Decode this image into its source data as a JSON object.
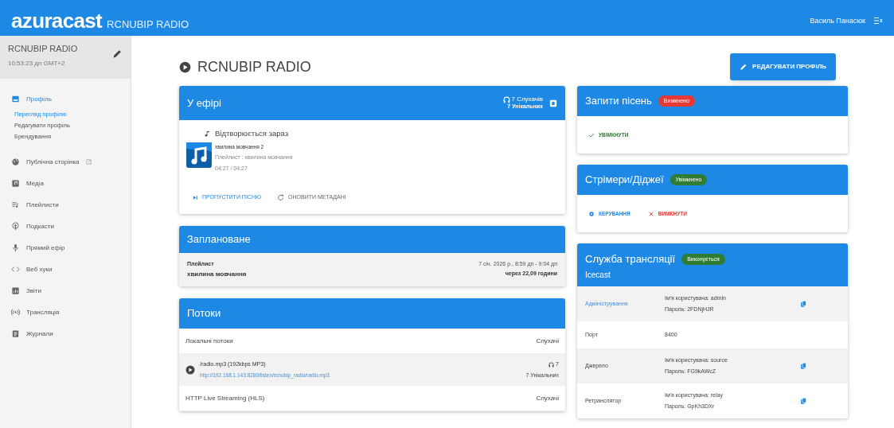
{
  "header": {
    "logo": "azuracast",
    "station": "RCNUBIP RADIO",
    "user": "Василь Панасюк"
  },
  "sidebar": {
    "station": "RCNUBIP RADIO",
    "time": "10:53:23 дп GMT+2",
    "items": [
      {
        "label": "Профіль",
        "selected": true,
        "external": false,
        "children": [
          {
            "label": "Перегляд профілю",
            "selected": true
          },
          {
            "label": "Редагувати профіль",
            "selected": false
          },
          {
            "label": "Брендування",
            "selected": false
          }
        ]
      },
      {
        "label": "Публічна сторінка",
        "selected": false,
        "external": true
      },
      {
        "label": "Медіа",
        "selected": false,
        "external": false
      },
      {
        "label": "Плейлисти",
        "selected": false,
        "external": false
      },
      {
        "label": "Подкасти",
        "selected": false,
        "external": false
      },
      {
        "label": "Прямий ефір",
        "selected": false,
        "external": false
      },
      {
        "label": "Веб хуки",
        "selected": false,
        "external": false
      },
      {
        "label": "Звіти",
        "selected": false,
        "external": false
      },
      {
        "label": "Трансляція",
        "selected": false,
        "external": false
      },
      {
        "label": "Журнали",
        "selected": false,
        "external": false
      }
    ]
  },
  "page": {
    "title": "RCNUBIP RADIO",
    "edit_button": "РЕДАГУВАТИ ПРОФІЛЬ"
  },
  "on_air": {
    "title": "У ефірі",
    "listeners": "7 Слухачів",
    "unique": "7 Унікальних",
    "now_playing": "Відтворюється зараз",
    "song": "хвилина мовчання 2",
    "playlist": "Плейлист : хвилина мовчання",
    "time": "04:27 / 04:27",
    "actions": [
      "ПРОПУСТИТИ ПІСНЮ",
      "ОНОВИТИ МЕТАДАНІ"
    ]
  },
  "scheduled": {
    "title": "Заплановане",
    "type": "Плейлист",
    "name": "хвилина мовчання",
    "when": "7 січ. 2026 р., 8:59 дп - 9:04 дп",
    "relative": "через 22,09 години"
  },
  "streams": {
    "title": "Потоки",
    "groups": [
      {
        "label": "Локальні потоки",
        "column": "Слухачі",
        "streams": [
          {
            "name": "/radio.mp3 (192kbps MP3)",
            "url": "http://192.168.1.143:8280/listen/rcnubip_radio/radio.mp3",
            "listeners": "7",
            "unique": "7 Унікальних"
          }
        ]
      },
      {
        "label": "HTTP Live Streaming (HLS)",
        "column": "Слухачі"
      }
    ]
  },
  "requests": {
    "title": "Запити пісень",
    "badge": {
      "label": "Вимкнено",
      "color": "#e53935"
    },
    "actions": [
      {
        "label": "УВІМКНУТИ",
        "kind": "enable"
      }
    ]
  },
  "streamers": {
    "title": "Стрімери/Діджеї",
    "badge": {
      "label": "Увімкнено",
      "color": "#2e7d32"
    },
    "actions": [
      {
        "label": "КЕРУВАННЯ",
        "kind": "manage"
      },
      {
        "label": "ВИМКНУТИ",
        "kind": "disable"
      }
    ]
  },
  "broadcast": {
    "title": "Служба трансляції",
    "subtitle": "Icecast",
    "badge": {
      "label": "Виконується",
      "color": "#2e7d32"
    },
    "rows": [
      {
        "label": "Адміністрування",
        "link": true,
        "lines": [
          "Ім'я користувача: admin",
          "Пароль: 2FDNjHJR"
        ],
        "copy": true
      },
      {
        "label": "Порт",
        "link": false,
        "lines": [
          "8400"
        ],
        "copy": false
      },
      {
        "label": "Джерело",
        "link": false,
        "lines": [
          "Ім'я користувача: source",
          "Пароль: FG9kAWcZ"
        ],
        "copy": true
      },
      {
        "label": "Ретранслятор",
        "link": false,
        "lines": [
          "Ім'я користувача: relay",
          "Пароль: GpKh3DXr"
        ],
        "copy": true
      }
    ]
  }
}
